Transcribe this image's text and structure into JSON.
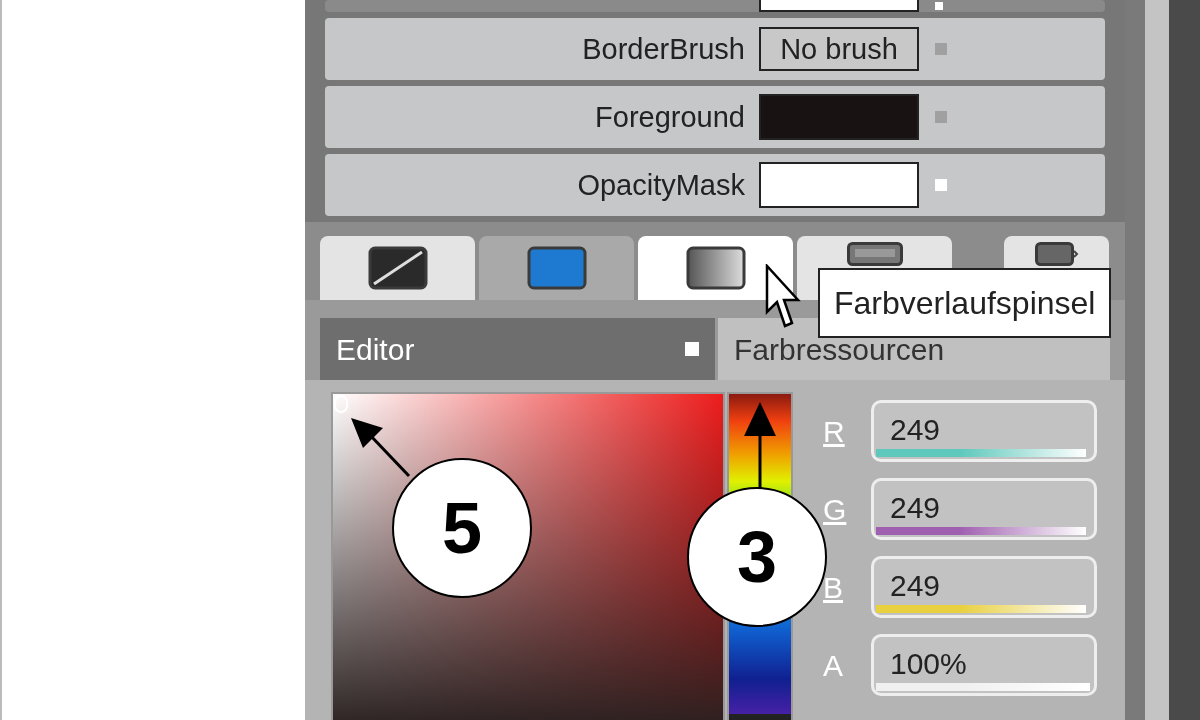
{
  "properties": [
    {
      "kind": "swatch",
      "color": "#ffffff",
      "local": true
    },
    {
      "label": "BorderBrush",
      "kind": "text",
      "value": "No brush",
      "local": false
    },
    {
      "label": "Foreground",
      "kind": "swatch",
      "color": "#181212",
      "local": false
    },
    {
      "label": "OpacityMask",
      "kind": "swatch",
      "color": "#ffffff",
      "local": true
    }
  ],
  "brush_tabs": [
    {
      "kind": "none",
      "selected": false,
      "current": false
    },
    {
      "kind": "solid",
      "selected": false,
      "current": true
    },
    {
      "kind": "gradient",
      "selected": true,
      "current": false
    },
    {
      "kind": "tile",
      "selected": false,
      "current": false
    },
    {
      "kind": "resource",
      "selected": false,
      "current": false
    }
  ],
  "tooltip": "Farbverlaufspinsel",
  "sub_tabs": [
    {
      "label": "Editor",
      "selected": true
    },
    {
      "label": "Farbressourcen",
      "selected": false
    }
  ],
  "hue": {
    "level": 0
  },
  "callouts": [
    "5",
    "3"
  ],
  "channels": [
    {
      "label": "R",
      "value": "249",
      "color": "#5ec8bc",
      "level": 0.98
    },
    {
      "label": "G",
      "value": "249",
      "color": "#a060b0",
      "level": 0.98
    },
    {
      "label": "B",
      "value": "249",
      "color": "#e8d040",
      "level": 0.98
    },
    {
      "label": "A",
      "value": "100%",
      "color": "#f0f0f0",
      "level": 1
    }
  ]
}
